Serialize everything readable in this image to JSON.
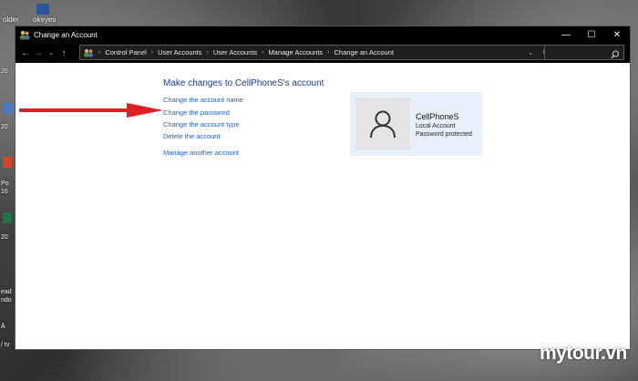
{
  "window": {
    "title": "Change an Account",
    "controls": {
      "minimize": "—",
      "maximize": "☐",
      "close": "✕"
    }
  },
  "desktop": {
    "top_labels": [
      "older",
      "okeyes"
    ],
    "side_labels": [
      "20",
      "20",
      "Po",
      "16",
      "20",
      "ead",
      "ndo",
      "Ā",
      "/ tv"
    ]
  },
  "address_bar": {
    "crumbs": [
      "Control Panel",
      "User Accounts",
      "User Accounts",
      "Manage Accounts",
      "Change an Account"
    ],
    "search_placeholder": ""
  },
  "main": {
    "heading": "Make changes to CellPhoneS's account",
    "links": {
      "change_name": "Change the account name",
      "change_password": "Change the password",
      "change_type": "Change the account type",
      "delete": "Delete the account",
      "manage_another": "Manage another account"
    }
  },
  "account": {
    "name": "CellPhoneS",
    "type": "Local Account",
    "status": "Password protected"
  },
  "watermark": "mytour.vn",
  "colors": {
    "heading": "#1e3b84",
    "link": "#1f5fbf",
    "card_bg": "#e6f1fb",
    "arrow": "#e02020",
    "titlebar": "#000000"
  }
}
